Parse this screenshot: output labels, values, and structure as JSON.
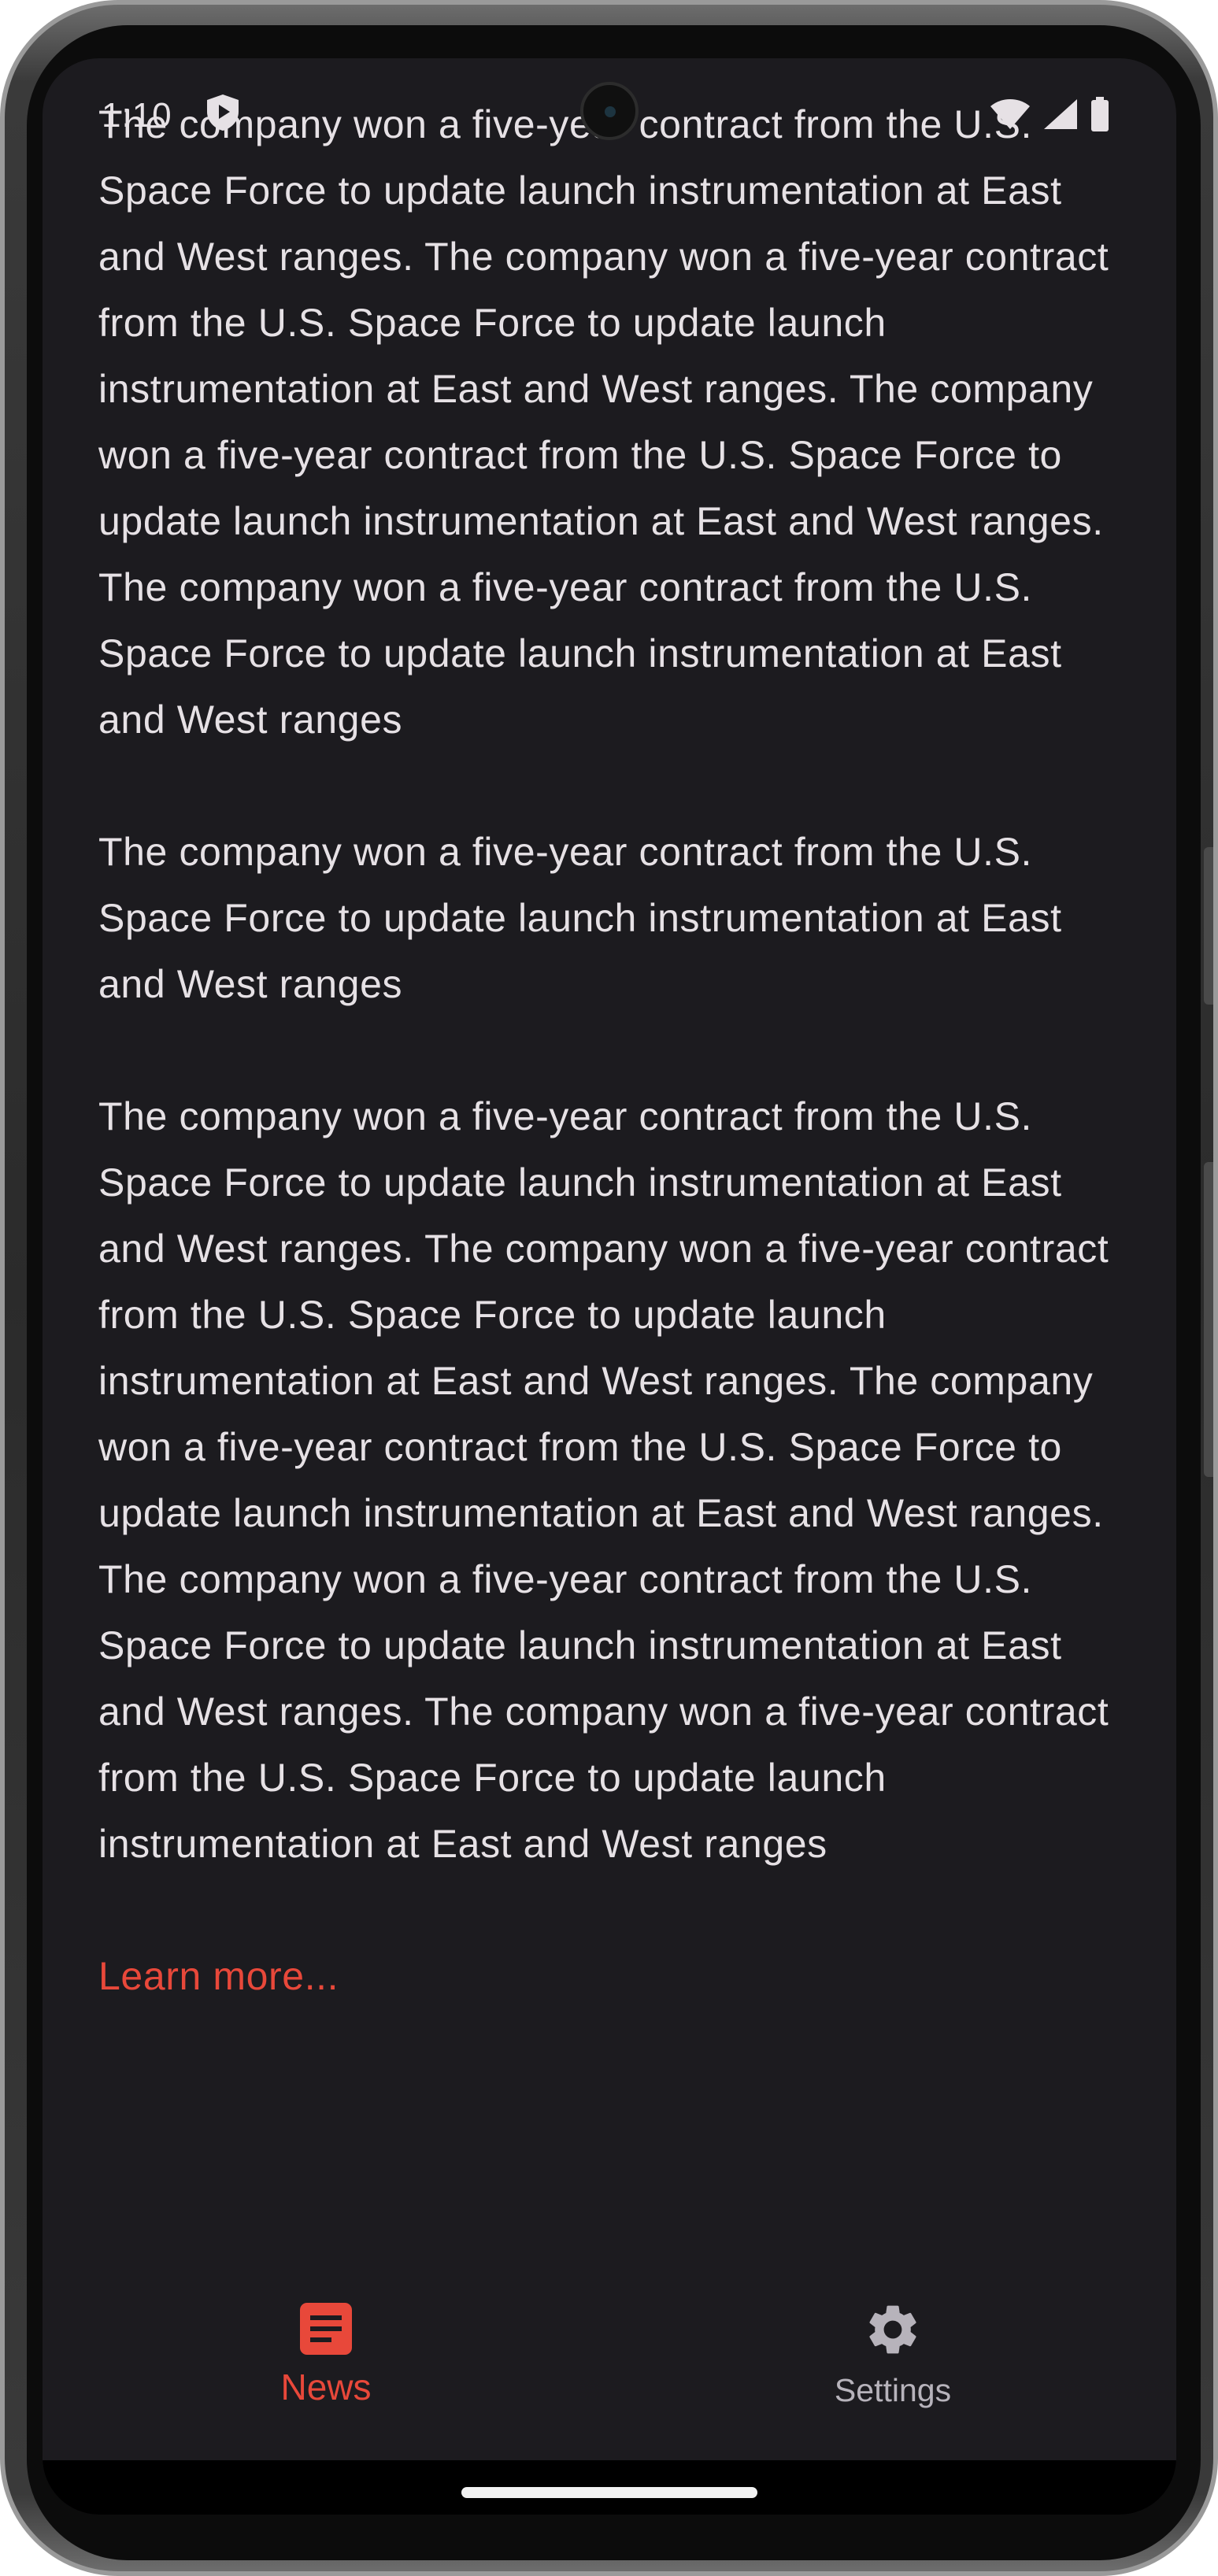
{
  "status_bar": {
    "time": "1:10"
  },
  "article": {
    "paragraphs": [
      "The company won a five-year contract from the U.S. Space Force to update launch instrumentation at East and West ranges. The company won a five-year contract from the U.S. Space Force to update launch instrumentation at East and West ranges. The company won a five-year contract from the U.S. Space Force to update launch instrumentation at East and West ranges. The company won a five-year contract from the U.S. Space Force to update launch instrumentation at East and West ranges",
      "The company won a five-year contract from the U.S. Space Force to update launch instrumentation at East and West ranges",
      "The company won a five-year contract from the U.S. Space Force to update launch instrumentation at East and West ranges. The company won a five-year contract from the U.S. Space Force to update launch instrumentation at East and West ranges. The company won a five-year contract from the U.S. Space Force to update launch instrumentation at East and West ranges. The company won a five-year contract from the U.S. Space Force to update launch instrumentation at East and West ranges. The company won a five-year contract from the U.S. Space Force to update launch instrumentation at East and West ranges"
    ],
    "learn_more": "Learn more..."
  },
  "bottom_nav": {
    "items": [
      {
        "label": "News",
        "icon": "article-icon",
        "selected": true
      },
      {
        "label": "Settings",
        "icon": "gear-icon",
        "selected": false
      }
    ]
  },
  "colors": {
    "background": "#1c1b1f",
    "text": "#e6e1e5",
    "accent": "#e8483a",
    "nav_inactive": "#b7b3bb"
  }
}
